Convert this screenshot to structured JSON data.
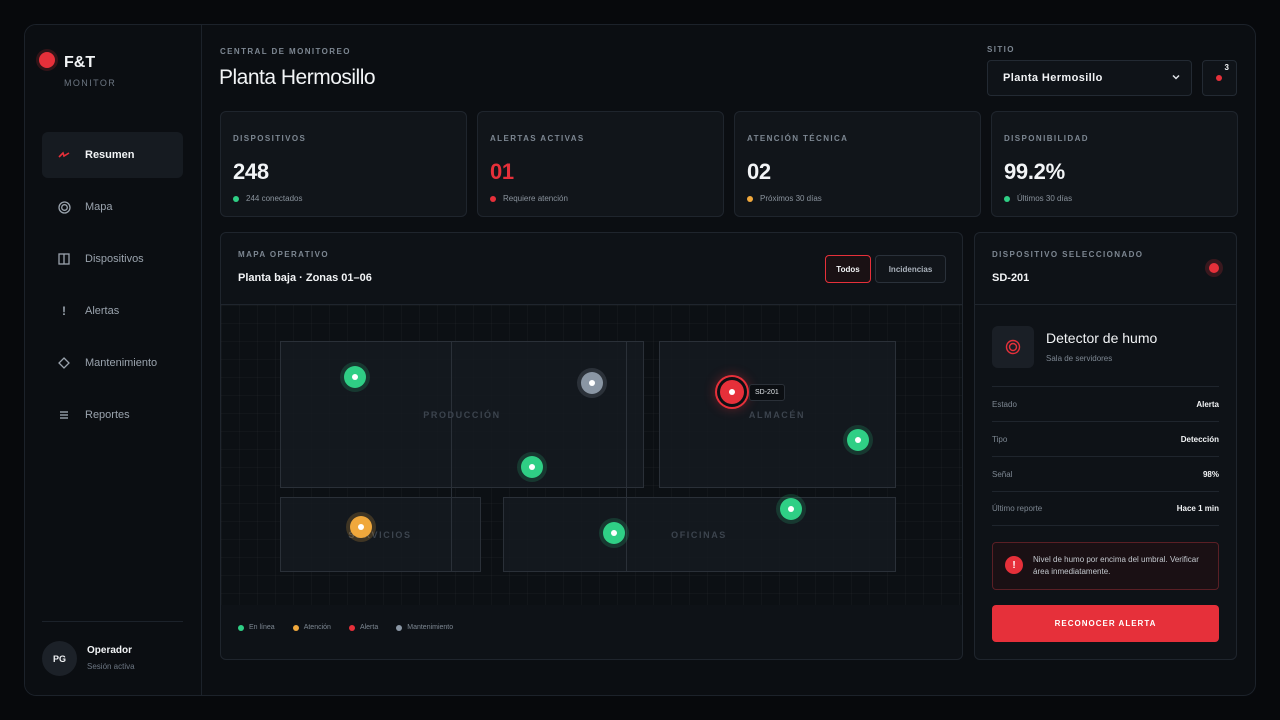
{
  "brand": {
    "name": "F&T",
    "subtitle": "MONITOR"
  },
  "sidebar": {
    "items": [
      {
        "label": "Resumen",
        "icon": "pulse-icon",
        "active": true
      },
      {
        "label": "Mapa",
        "icon": "target-icon"
      },
      {
        "label": "Dispositivos",
        "icon": "columns-icon"
      },
      {
        "label": "Alertas",
        "icon": "exclamation-icon"
      },
      {
        "label": "Mantenimiento",
        "icon": "diamond-icon"
      },
      {
        "label": "Reportes",
        "icon": "list-icon"
      }
    ],
    "user": {
      "initials": "PG",
      "name": "Operador",
      "status": "Sesión activa"
    }
  },
  "header": {
    "eyebrow": "CENTRAL DE MONITOREO",
    "title": "Planta Hermosillo",
    "site_label": "SITIO",
    "site_value": "Planta Hermosillo",
    "notifications_count": "3"
  },
  "stats": [
    {
      "label": "DISPOSITIVOS",
      "value": "248",
      "note": "244 conectados",
      "status": "green"
    },
    {
      "label": "ALERTAS ACTIVAS",
      "value": "01",
      "note": "Requiere atención",
      "status": "red"
    },
    {
      "label": "ATENCIÓN TÉCNICA",
      "value": "02",
      "note": "Próximos 30 días",
      "status": "orange"
    },
    {
      "label": "DISPONIBILIDAD",
      "value": "99.2%",
      "note": "Últimos 30 días",
      "status": "green"
    }
  ],
  "map": {
    "eyebrow": "MAPA OPERATIVO",
    "subtitle": "Planta baja · Zonas 01–06",
    "filters": [
      "Todos",
      "Incidencias"
    ],
    "zones": [
      "PRODUCCIÓN",
      "ALMACÉN",
      "SERVICIOS",
      "OFICINAS"
    ],
    "pin_tag": "SD-201",
    "legend": [
      {
        "label": "En línea",
        "color": "#2fcf85"
      },
      {
        "label": "Atención",
        "color": "#f0a83c"
      },
      {
        "label": "Alerta",
        "color": "#e6303a"
      },
      {
        "label": "Mantenimiento",
        "color": "#8a96a4"
      }
    ]
  },
  "detail": {
    "eyebrow": "DISPOSITIVO SELECCIONADO",
    "id": "SD-201",
    "name": "Detector de humo",
    "location": "Sala de servidores",
    "rows": [
      {
        "label": "Estado",
        "value": "Alerta"
      },
      {
        "label": "Tipo",
        "value": "Detección"
      },
      {
        "label": "Señal",
        "value": "98%"
      },
      {
        "label": "Último reporte",
        "value": "Hace 1 min"
      }
    ],
    "alert_message": "Nivel de humo por encima del umbral. Verificar área inmediatamente.",
    "ack_button": "RECONOCER ALERTA"
  },
  "colors": {
    "accent": "#e6303a",
    "online": "#2fcf85",
    "attention": "#f0a83c",
    "maintenance": "#8a96a4"
  }
}
